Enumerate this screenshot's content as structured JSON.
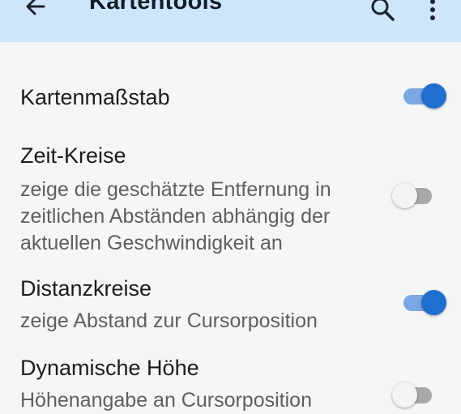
{
  "appbar": {
    "title": "Kartentools",
    "back_icon": "arrow-back-icon",
    "search_icon": "search-icon",
    "more_icon": "more-vertical-icon",
    "background": "#cde6fc"
  },
  "settings": [
    {
      "label": "Kartenmaßstab",
      "desc_lines": [],
      "enabled": true
    },
    {
      "label": "Zeit-Kreise",
      "desc_lines": [
        "zeige die geschätzte Entfernung in",
        "zeitlichen Abständen abhängig der",
        "aktuellen Geschwindigkeit an"
      ],
      "enabled": false
    },
    {
      "label": "Distanzkreise",
      "desc_lines": [
        "zeige Abstand zur Cursorposition"
      ],
      "enabled": true
    },
    {
      "label": "Dynamische Höhe",
      "desc_lines": [
        "Höhenangabe an Cursorposition"
      ],
      "enabled": false
    }
  ],
  "colors": {
    "accent": "#1f6fd1",
    "accent_track": "#7aa8e3",
    "off_track": "#a9a9a9"
  }
}
